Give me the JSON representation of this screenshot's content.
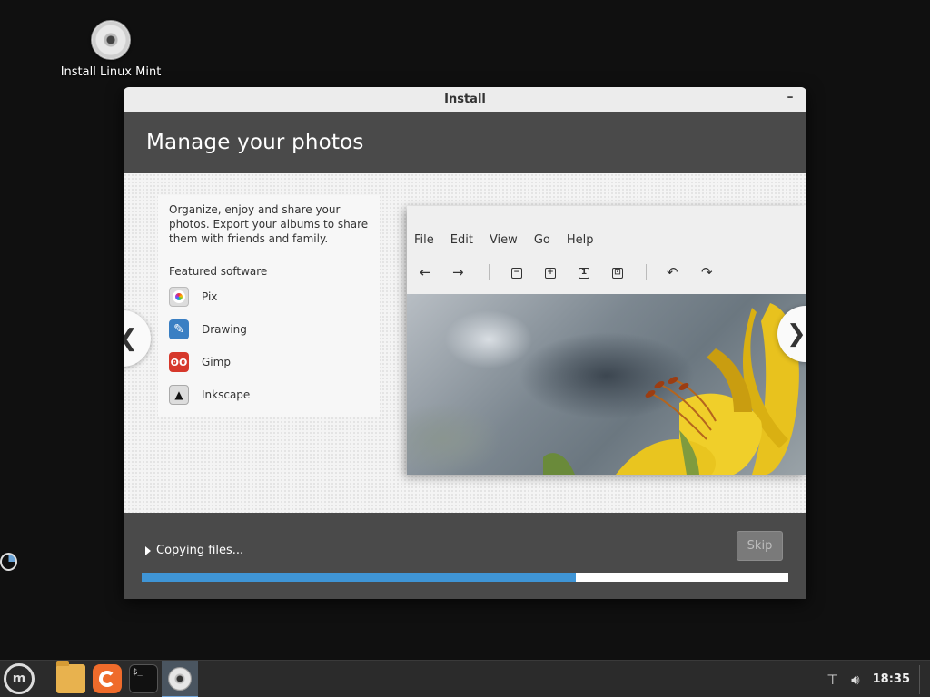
{
  "desktop": {
    "icon_label": "Install Linux Mint"
  },
  "window": {
    "title": "Install",
    "minimize_glyph": "–"
  },
  "slide": {
    "heading": "Manage your photos",
    "description": "Organize, enjoy and share your photos. Export your albums to share them with friends and family.",
    "featured_heading": "Featured software",
    "apps": [
      {
        "name": "Pix",
        "icon": "pix-icon"
      },
      {
        "name": "Drawing",
        "icon": "drawing-icon"
      },
      {
        "name": "Gimp",
        "icon": "gimp-icon"
      },
      {
        "name": "Inkscape",
        "icon": "inkscape-icon"
      }
    ],
    "preview_menu": [
      "File",
      "Edit",
      "View",
      "Go",
      "Help"
    ],
    "preview_toolbar": {
      "back": "←",
      "forward": "→",
      "zoom_out": "−",
      "zoom_in": "+",
      "zoom_normal": "1",
      "zoom_fit": "⊡",
      "rotate_left": "↶",
      "rotate_right": "↷"
    },
    "prev_glyph": "❮",
    "next_glyph": "❯"
  },
  "footer": {
    "status": "Copying files...",
    "skip_label": "Skip",
    "progress_fraction": 0.672,
    "progress_color": "#3f95d6"
  },
  "taskbar": {
    "clock": "18:35",
    "terminal_glyph": "$_",
    "mint_glyph": "m"
  },
  "colors": {
    "desktop_bg": "#101010",
    "window_header": "#4a4a4a",
    "accent": "#3f95d6"
  }
}
